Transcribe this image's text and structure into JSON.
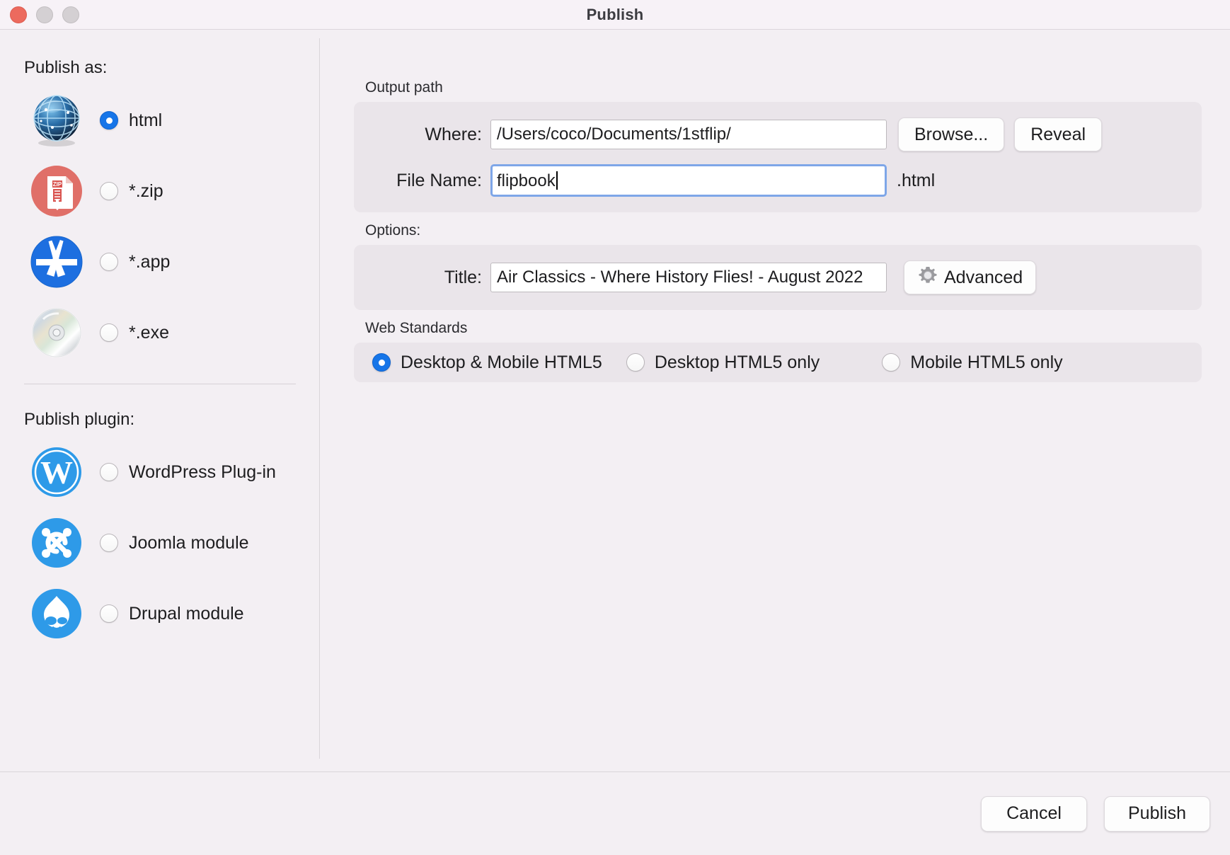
{
  "window": {
    "title": "Publish",
    "traffic_lights": [
      "close",
      "minimize",
      "maximize"
    ]
  },
  "sidebar": {
    "publish_as_label": "Publish as:",
    "publish_plugin_label": "Publish plugin:",
    "formats": [
      {
        "label": "html",
        "icon": "globe-icon",
        "selected": true
      },
      {
        "label": "*.zip",
        "icon": "zip-icon",
        "selected": false
      },
      {
        "label": "*.app",
        "icon": "appstore-icon",
        "selected": false
      },
      {
        "label": "*.exe",
        "icon": "disc-icon",
        "selected": false
      }
    ],
    "plugins": [
      {
        "label": "WordPress Plug-in",
        "icon": "wordpress-icon",
        "selected": false
      },
      {
        "label": "Joomla module",
        "icon": "joomla-icon",
        "selected": false
      },
      {
        "label": "Drupal module",
        "icon": "drupal-icon",
        "selected": false
      }
    ]
  },
  "output_path": {
    "caption": "Output path",
    "where_label": "Where:",
    "where_value": "/Users/coco/Documents/1stflip/",
    "browse_label": "Browse...",
    "reveal_label": "Reveal",
    "filename_label": "File Name:",
    "filename_value": "flipbook",
    "extension": ".html"
  },
  "options": {
    "caption": "Options:",
    "title_label": "Title:",
    "title_value": "Air Classics - Where History Flies! - August 2022",
    "advanced_label": "Advanced",
    "advanced_icon": "gear-icon"
  },
  "web_standards": {
    "caption": "Web Standards",
    "items": [
      {
        "label": "Desktop & Mobile HTML5",
        "selected": true
      },
      {
        "label": "Desktop HTML5 only",
        "selected": false
      },
      {
        "label": "Mobile HTML5 only",
        "selected": false
      }
    ]
  },
  "footer": {
    "cancel_label": "Cancel",
    "publish_label": "Publish"
  },
  "colors": {
    "accent_blue": "#1675e8",
    "focus_border": "#7ea6e8",
    "window_bg": "#f3eff3",
    "group_bg": "#eae5ea",
    "close_red": "#ec6a5e"
  }
}
